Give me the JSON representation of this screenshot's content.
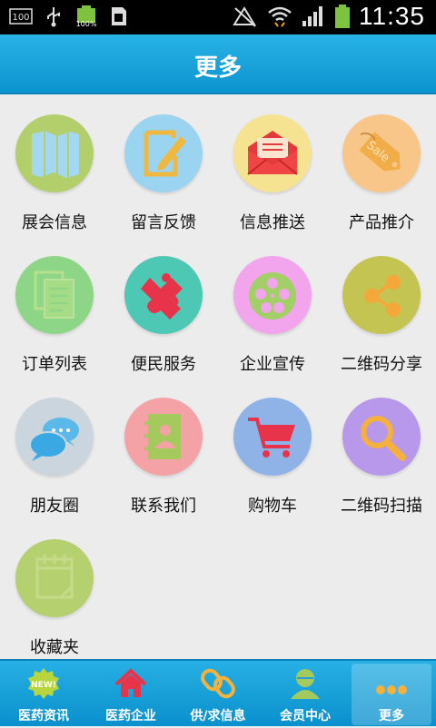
{
  "status_bar": {
    "time": "11:35",
    "battery_text": "100%",
    "left_box_text": "100"
  },
  "title": "更多",
  "grid_items": [
    {
      "label": "展会信息",
      "icon": "map-icon",
      "color": "#b2cf6b"
    },
    {
      "label": "留言反馈",
      "icon": "pencil-edit-icon",
      "color": "#9ad4f1"
    },
    {
      "label": "信息推送",
      "icon": "mail-icon",
      "color": "#f6e391"
    },
    {
      "label": "产品推介",
      "icon": "sale-tag-icon",
      "color": "#f8c688"
    },
    {
      "label": "订单列表",
      "icon": "documents-icon",
      "color": "#8ed687"
    },
    {
      "label": "便民服务",
      "icon": "puzzle-icon",
      "color": "#4cc8b4"
    },
    {
      "label": "企业宣传",
      "icon": "film-reel-icon",
      "color": "#f2a4ec"
    },
    {
      "label": "二维码分享",
      "icon": "share-icon",
      "color": "#c4c453"
    },
    {
      "label": "朋友圈",
      "icon": "chat-bubbles-icon",
      "color": "#cbd5dd"
    },
    {
      "label": "联系我们",
      "icon": "contacts-book-icon",
      "color": "#f5a2a6"
    },
    {
      "label": "购物车",
      "icon": "shopping-cart-icon",
      "color": "#8fb3e6"
    },
    {
      "label": "二维码扫描",
      "icon": "magnifier-icon",
      "color": "#b898eb"
    },
    {
      "label": "收藏夹",
      "icon": "calendar-notes-icon",
      "color": "#b5d06e"
    }
  ],
  "tabs": [
    {
      "label": "医药资讯",
      "icon": "new-badge-icon",
      "active": false
    },
    {
      "label": "医药企业",
      "icon": "house-icon",
      "active": false
    },
    {
      "label": "供/求信息",
      "icon": "chain-link-icon",
      "active": false
    },
    {
      "label": "会员中心",
      "icon": "user-icon",
      "active": false
    },
    {
      "label": "更多",
      "icon": "more-dots-icon",
      "active": true
    }
  ]
}
